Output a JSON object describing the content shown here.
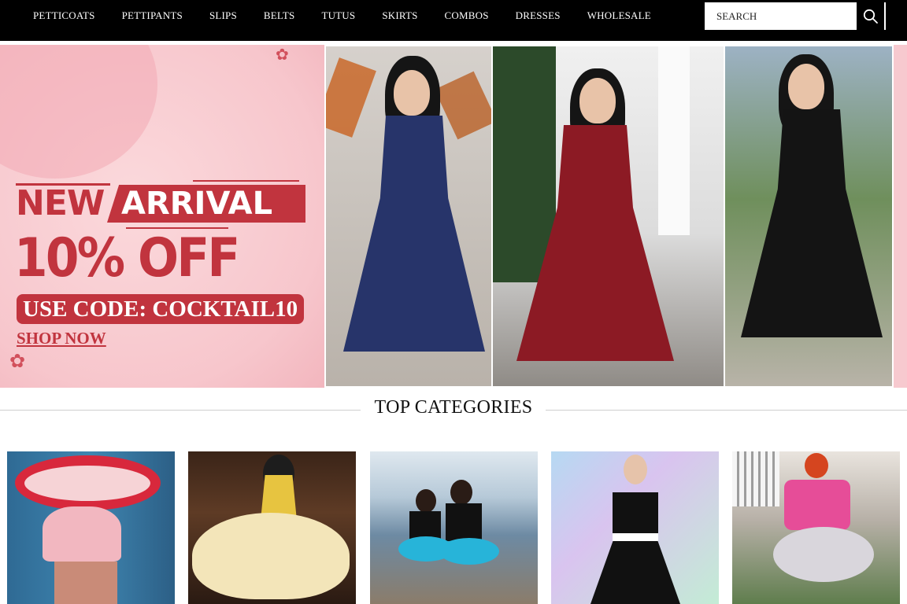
{
  "nav": {
    "items": [
      "PETTICOATS",
      "PETTIPANTS",
      "SLIPS",
      "BELTS",
      "TUTUS",
      "SKIRTS",
      "COMBOS",
      "DRESSES",
      "WHOLESALE"
    ],
    "search_placeholder": "SEARCH"
  },
  "hero": {
    "headline_new": "NEW",
    "headline_arrival": "ARRIVAL",
    "discount": "10% OFF",
    "code": "USE CODE: COCKTAIL10",
    "cta": "SHOP NOW",
    "dress_colors": [
      "#27346a",
      "#8c1a24",
      "#141414"
    ]
  },
  "categories": {
    "title": "TOP CATEGORIES"
  },
  "colors": {
    "accent": "#c1343e",
    "nav_bg": "#000000",
    "hero_bg": "#f7c9cf"
  }
}
